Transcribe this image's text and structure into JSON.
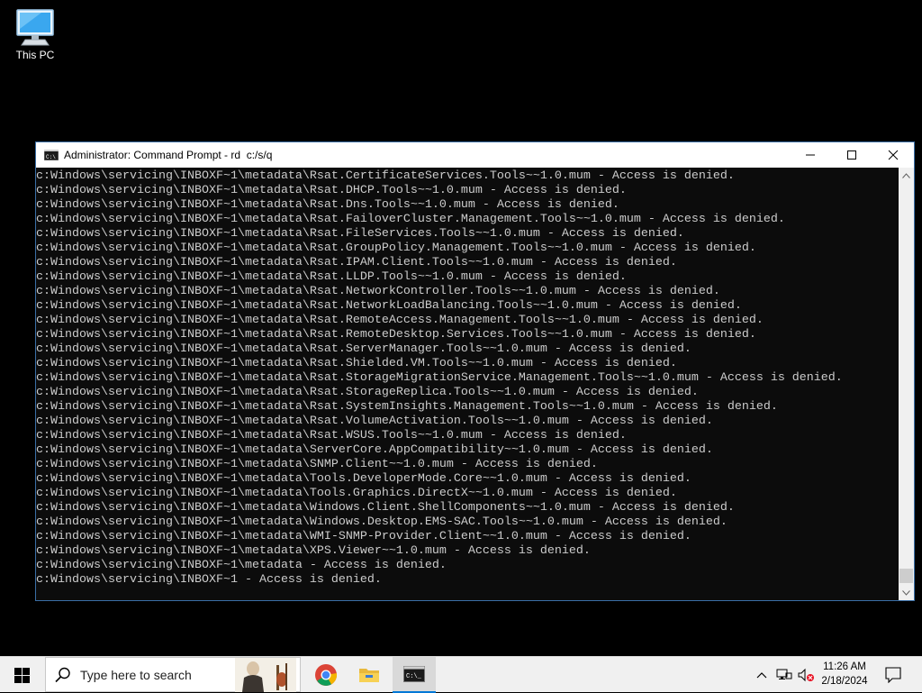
{
  "desktop": {
    "icons": [
      {
        "label": "This PC",
        "icon": "monitor-icon"
      }
    ]
  },
  "window": {
    "title": "Administrator: Command Prompt - rd  c:/s/q",
    "controls": {
      "minimize": "minimize-icon",
      "maximize": "maximize-icon",
      "close": "close-icon"
    }
  },
  "console": {
    "lines": [
      "c:Windows\\servicing\\INBOXF~1\\metadata\\Rsat.CertificateServices.Tools~~1.0.mum - Access is denied.",
      "c:Windows\\servicing\\INBOXF~1\\metadata\\Rsat.DHCP.Tools~~1.0.mum - Access is denied.",
      "c:Windows\\servicing\\INBOXF~1\\metadata\\Rsat.Dns.Tools~~1.0.mum - Access is denied.",
      "c:Windows\\servicing\\INBOXF~1\\metadata\\Rsat.FailoverCluster.Management.Tools~~1.0.mum - Access is denied.",
      "c:Windows\\servicing\\INBOXF~1\\metadata\\Rsat.FileServices.Tools~~1.0.mum - Access is denied.",
      "c:Windows\\servicing\\INBOXF~1\\metadata\\Rsat.GroupPolicy.Management.Tools~~1.0.mum - Access is denied.",
      "c:Windows\\servicing\\INBOXF~1\\metadata\\Rsat.IPAM.Client.Tools~~1.0.mum - Access is denied.",
      "c:Windows\\servicing\\INBOXF~1\\metadata\\Rsat.LLDP.Tools~~1.0.mum - Access is denied.",
      "c:Windows\\servicing\\INBOXF~1\\metadata\\Rsat.NetworkController.Tools~~1.0.mum - Access is denied.",
      "c:Windows\\servicing\\INBOXF~1\\metadata\\Rsat.NetworkLoadBalancing.Tools~~1.0.mum - Access is denied.",
      "c:Windows\\servicing\\INBOXF~1\\metadata\\Rsat.RemoteAccess.Management.Tools~~1.0.mum - Access is denied.",
      "c:Windows\\servicing\\INBOXF~1\\metadata\\Rsat.RemoteDesktop.Services.Tools~~1.0.mum - Access is denied.",
      "c:Windows\\servicing\\INBOXF~1\\metadata\\Rsat.ServerManager.Tools~~1.0.mum - Access is denied.",
      "c:Windows\\servicing\\INBOXF~1\\metadata\\Rsat.Shielded.VM.Tools~~1.0.mum - Access is denied.",
      "c:Windows\\servicing\\INBOXF~1\\metadata\\Rsat.StorageMigrationService.Management.Tools~~1.0.mum - Access is denied.",
      "c:Windows\\servicing\\INBOXF~1\\metadata\\Rsat.StorageReplica.Tools~~1.0.mum - Access is denied.",
      "c:Windows\\servicing\\INBOXF~1\\metadata\\Rsat.SystemInsights.Management.Tools~~1.0.mum - Access is denied.",
      "c:Windows\\servicing\\INBOXF~1\\metadata\\Rsat.VolumeActivation.Tools~~1.0.mum - Access is denied.",
      "c:Windows\\servicing\\INBOXF~1\\metadata\\Rsat.WSUS.Tools~~1.0.mum - Access is denied.",
      "c:Windows\\servicing\\INBOXF~1\\metadata\\ServerCore.AppCompatibility~~1.0.mum - Access is denied.",
      "c:Windows\\servicing\\INBOXF~1\\metadata\\SNMP.Client~~1.0.mum - Access is denied.",
      "c:Windows\\servicing\\INBOXF~1\\metadata\\Tools.DeveloperMode.Core~~1.0.mum - Access is denied.",
      "c:Windows\\servicing\\INBOXF~1\\metadata\\Tools.Graphics.DirectX~~1.0.mum - Access is denied.",
      "c:Windows\\servicing\\INBOXF~1\\metadata\\Windows.Client.ShellComponents~~1.0.mum - Access is denied.",
      "c:Windows\\servicing\\INBOXF~1\\metadata\\Windows.Desktop.EMS-SAC.Tools~~1.0.mum - Access is denied.",
      "c:Windows\\servicing\\INBOXF~1\\metadata\\WMI-SNMP-Provider.Client~~1.0.mum - Access is denied.",
      "c:Windows\\servicing\\INBOXF~1\\metadata\\XPS.Viewer~~1.0.mum - Access is denied.",
      "c:Windows\\servicing\\INBOXF~1\\metadata - Access is denied.",
      "c:Windows\\servicing\\INBOXF~1 - Access is denied."
    ]
  },
  "taskbar": {
    "start_icon": "windows-logo-icon",
    "search": {
      "placeholder": "Type here to search",
      "icon": "search-icon"
    },
    "apps": [
      {
        "name": "chrome",
        "icon": "chrome-icon",
        "active": false
      },
      {
        "name": "file-explorer",
        "icon": "folder-icon",
        "active": false
      },
      {
        "name": "command-prompt",
        "icon": "cmd-icon",
        "active": true
      }
    ],
    "tray": {
      "icons": [
        "chevron-up-icon",
        "network-icon",
        "volume-muted-icon"
      ]
    },
    "clock": {
      "time": "11:26 AM",
      "date": "2/18/2024"
    },
    "notifications_icon": "notification-icon"
  },
  "colors": {
    "accent": "#0078d7",
    "console_bg": "#0c0c0c",
    "console_fg": "#cccccc"
  }
}
